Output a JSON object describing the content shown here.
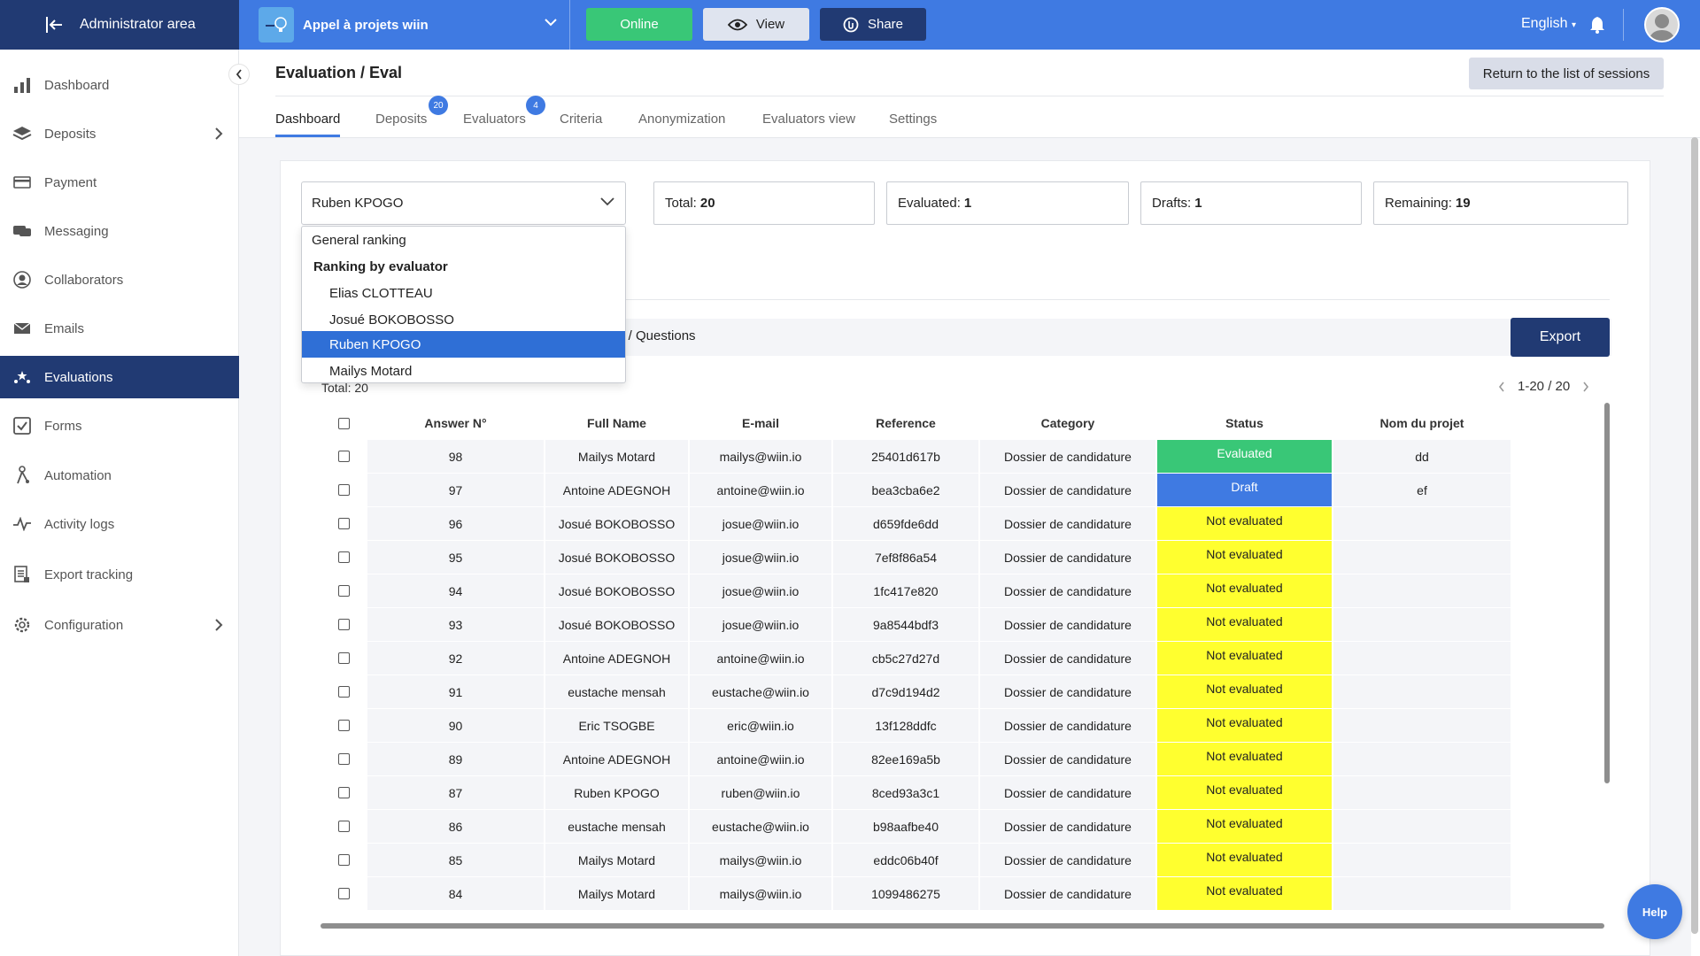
{
  "topbar": {
    "admin_label": "Administrator area",
    "project_name": "Appel à projets wiin",
    "online_label": "Online",
    "view_label": "View",
    "share_label": "Share",
    "language": "English"
  },
  "sidebar": {
    "items": [
      {
        "label": "Dashboard",
        "icon": "bar-chart-icon"
      },
      {
        "label": "Deposits",
        "icon": "layers-icon"
      },
      {
        "label": "Payment",
        "icon": "credit-card-icon"
      },
      {
        "label": "Messaging",
        "icon": "chat-icon"
      },
      {
        "label": "Collaborators",
        "icon": "user-circle-icon"
      },
      {
        "label": "Emails",
        "icon": "envelope-icon"
      },
      {
        "label": "Evaluations",
        "icon": "stars-icon"
      },
      {
        "label": "Forms",
        "icon": "checkbox-icon"
      },
      {
        "label": "Automation",
        "icon": "automation-icon"
      },
      {
        "label": "Activity logs",
        "icon": "activity-icon"
      },
      {
        "label": "Export tracking",
        "icon": "document-icon"
      },
      {
        "label": "Configuration",
        "icon": "gear-icon"
      }
    ]
  },
  "header": {
    "title": "Evaluation / Eval",
    "return_label": "Return to the list of sessions"
  },
  "tabs": [
    {
      "label": "Dashboard"
    },
    {
      "label": "Deposits",
      "badge": "20"
    },
    {
      "label": "Evaluators",
      "badge": "4"
    },
    {
      "label": "Criteria"
    },
    {
      "label": "Anonymization"
    },
    {
      "label": "Evaluators view"
    },
    {
      "label": "Settings"
    }
  ],
  "filter": {
    "selected": "Ruben KPOGO",
    "options": {
      "general": "General ranking",
      "group_label": "Ranking by evaluator",
      "evaluators": [
        "Elias CLOTTEAU",
        "Josué BOKOBOSSO",
        "Ruben KPOGO",
        "Mailys Motard"
      ]
    }
  },
  "stats": {
    "total_label": "Total:",
    "total": "20",
    "evaluated_label": "Evaluated:",
    "evaluated": "1",
    "drafts_label": "Drafts:",
    "drafts": "1",
    "remaining_label": "Remaining:",
    "remaining": "19"
  },
  "questions_label": "s / Questions",
  "export_label": "Export",
  "total_line": "Total: 20",
  "pager_text": "1-20 / 20",
  "table": {
    "headers": [
      "Answer N°",
      "Full Name",
      "E-mail",
      "Reference",
      "Category",
      "Status",
      "Nom du projet"
    ],
    "rows": [
      [
        "98",
        "Mailys Motard",
        "mailys@wiin.io",
        "25401d617b",
        "Dossier de candidature",
        "Evaluated",
        "dd"
      ],
      [
        "97",
        "Antoine ADEGNOH",
        "antoine@wiin.io",
        "bea3cba6e2",
        "Dossier de candidature",
        "Draft",
        "ef"
      ],
      [
        "96",
        "Josué BOKOBOSSO",
        "josue@wiin.io",
        "d659fde6dd",
        "Dossier de candidature",
        "Not evaluated",
        ""
      ],
      [
        "95",
        "Josué BOKOBOSSO",
        "josue@wiin.io",
        "7ef8f86a54",
        "Dossier de candidature",
        "Not evaluated",
        ""
      ],
      [
        "94",
        "Josué BOKOBOSSO",
        "josue@wiin.io",
        "1fc417e820",
        "Dossier de candidature",
        "Not evaluated",
        ""
      ],
      [
        "93",
        "Josué BOKOBOSSO",
        "josue@wiin.io",
        "9a8544bdf3",
        "Dossier de candidature",
        "Not evaluated",
        ""
      ],
      [
        "92",
        "Antoine ADEGNOH",
        "antoine@wiin.io",
        "cb5c27d27d",
        "Dossier de candidature",
        "Not evaluated",
        ""
      ],
      [
        "91",
        "eustache mensah",
        "eustache@wiin.io",
        "d7c9d194d2",
        "Dossier de candidature",
        "Not evaluated",
        ""
      ],
      [
        "90",
        "Eric TSOGBE",
        "eric@wiin.io",
        "13f128ddfc",
        "Dossier de candidature",
        "Not evaluated",
        ""
      ],
      [
        "89",
        "Antoine ADEGNOH",
        "antoine@wiin.io",
        "82ee169a5b",
        "Dossier de candidature",
        "Not evaluated",
        ""
      ],
      [
        "87",
        "Ruben KPOGO",
        "ruben@wiin.io",
        "8ced93a3c1",
        "Dossier de candidature",
        "Not evaluated",
        ""
      ],
      [
        "86",
        "eustache mensah",
        "eustache@wiin.io",
        "b98aafbe40",
        "Dossier de candidature",
        "Not evaluated",
        ""
      ],
      [
        "85",
        "Mailys Motard",
        "mailys@wiin.io",
        "eddc06b40f",
        "Dossier de candidature",
        "Not evaluated",
        ""
      ],
      [
        "84",
        "Mailys Motard",
        "mailys@wiin.io",
        "1099486275",
        "Dossier de candidature",
        "Not evaluated",
        ""
      ]
    ]
  },
  "help_label": "Help",
  "colors": {
    "topbar": "#3f7ae2",
    "navy": "#213a73",
    "evaluated": "#39c777",
    "draft": "#3f7ae2",
    "not_evaluated": "#ffff2f"
  }
}
